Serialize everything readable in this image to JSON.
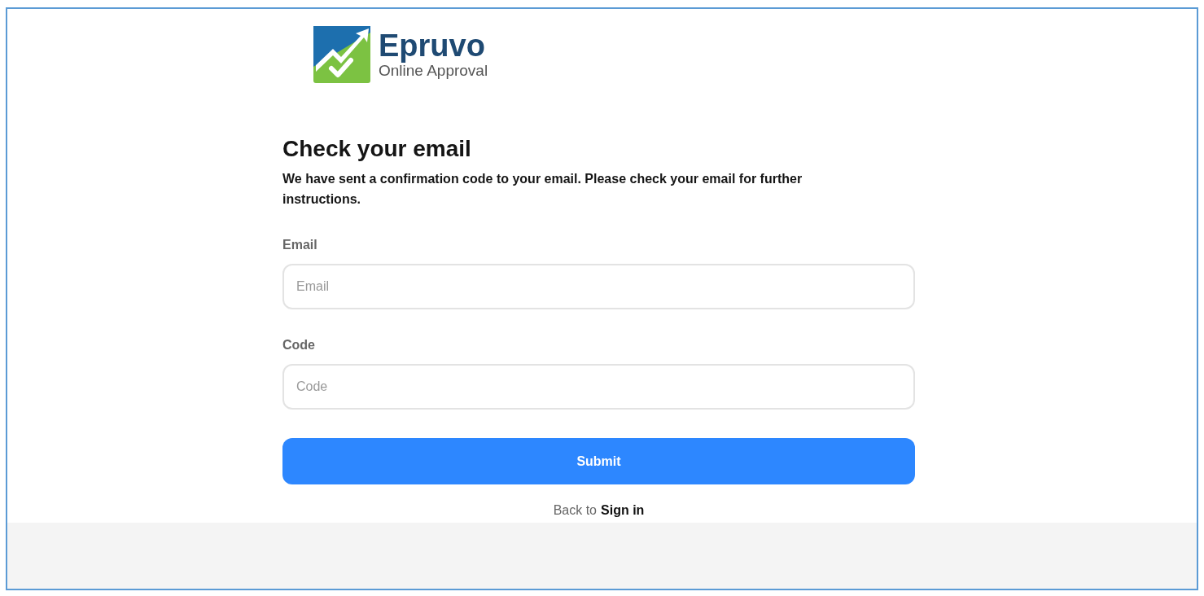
{
  "logo": {
    "name": "Epruvo",
    "tagline": "Online Approval"
  },
  "heading": "Check your email",
  "description": "We have sent a confirmation code to your email. Please check your email for further instructions.",
  "fields": [
    {
      "label": "Email",
      "placeholder": "Email"
    },
    {
      "label": "Code",
      "placeholder": "Code"
    }
  ],
  "submit_button": "Submit",
  "footer_link": {
    "prefix": "Back to",
    "link": "Sign in"
  }
}
